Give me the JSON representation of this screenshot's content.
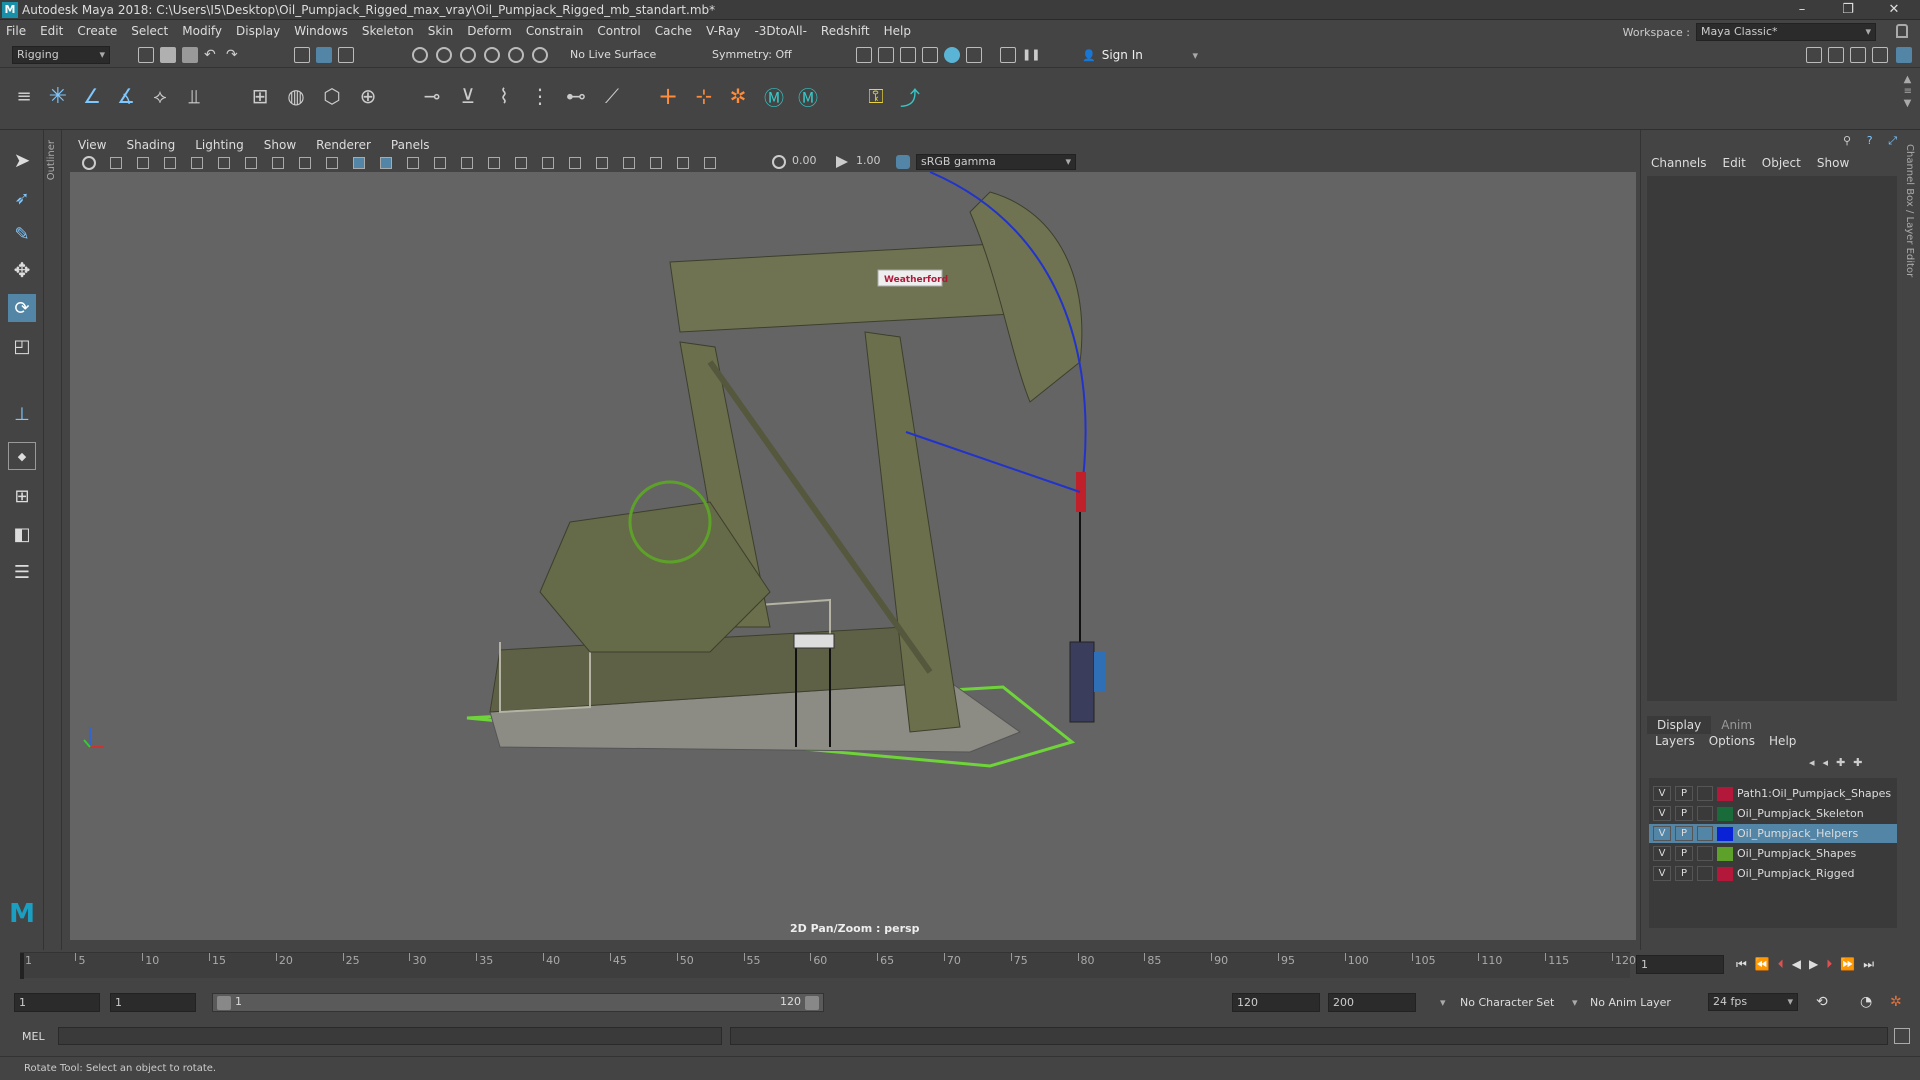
{
  "window": {
    "title": "Autodesk Maya 2018: C:\\Users\\I5\\Desktop\\Oil_Pumpjack_Rigged_max_vray\\Oil_Pumpjack_Rigged_mb_standart.mb*",
    "logo": "M",
    "minimize": "–",
    "restore": "❐",
    "close": "✕"
  },
  "menubar": {
    "items": [
      "File",
      "Edit",
      "Create",
      "Select",
      "Modify",
      "Display",
      "Windows",
      "Skeleton",
      "Skin",
      "Deform",
      "Constrain",
      "Control",
      "Cache",
      "V-Ray",
      "-3DtoAll-",
      "Redshift",
      "Help"
    ],
    "workspace_label": "Workspace :",
    "workspace_value": "Maya Classic*"
  },
  "statusline": {
    "menuset": "Rigging",
    "live_surface": "No Live Surface",
    "symmetry": "Symmetry: Off",
    "sign_in": "Sign In"
  },
  "outliner_tab": "Outliner",
  "panel": {
    "menus": [
      "View",
      "Shading",
      "Lighting",
      "Show",
      "Renderer",
      "Panels"
    ],
    "exposure": "0.00",
    "gamma": "1.00",
    "colorspace": "sRGB gamma",
    "camera_label": "2D Pan/Zoom : persp",
    "brand_sign": "Weatherford"
  },
  "channelbox": {
    "menus": [
      "Channels",
      "Edit",
      "Object",
      "Show"
    ],
    "dock_label": "Channel Box / Layer Editor"
  },
  "layereditor": {
    "tabs": [
      "Display",
      "Anim"
    ],
    "menus": [
      "Layers",
      "Options",
      "Help"
    ],
    "layers": [
      {
        "v": "V",
        "p": "P",
        "name": "Path1:Oil_Pumpjack_Shapes",
        "color": "#b3173a",
        "selected": false
      },
      {
        "v": "V",
        "p": "P",
        "name": "Oil_Pumpjack_Skeleton",
        "color": "#1a6b3a",
        "selected": false
      },
      {
        "v": "V",
        "p": "P",
        "name": "Oil_Pumpjack_Helpers",
        "color": "#0a22d6",
        "selected": true
      },
      {
        "v": "V",
        "p": "P",
        "name": "Oil_Pumpjack_Shapes",
        "color": "#5ea12a",
        "selected": false
      },
      {
        "v": "V",
        "p": "P",
        "name": "Oil_Pumpjack_Rigged",
        "color": "#b3173a",
        "selected": false
      }
    ]
  },
  "timeslider": {
    "ticks": [
      "1",
      "5",
      "10",
      "15",
      "20",
      "25",
      "30",
      "35",
      "40",
      "45",
      "50",
      "55",
      "60",
      "65",
      "70",
      "75",
      "80",
      "85",
      "90",
      "95",
      "100",
      "105",
      "110",
      "115",
      "120"
    ],
    "current_frame": "1"
  },
  "rangeslider": {
    "start": "1",
    "playback_start": "1",
    "range_low": "1",
    "range_high": "120",
    "playback_end": "120",
    "end": "200",
    "character_set": "No Character Set",
    "anim_layer": "No Anim Layer",
    "fps": "24 fps"
  },
  "cmdline": {
    "label": "MEL"
  },
  "helpline": {
    "text": "Rotate Tool: Select an object to rotate."
  }
}
